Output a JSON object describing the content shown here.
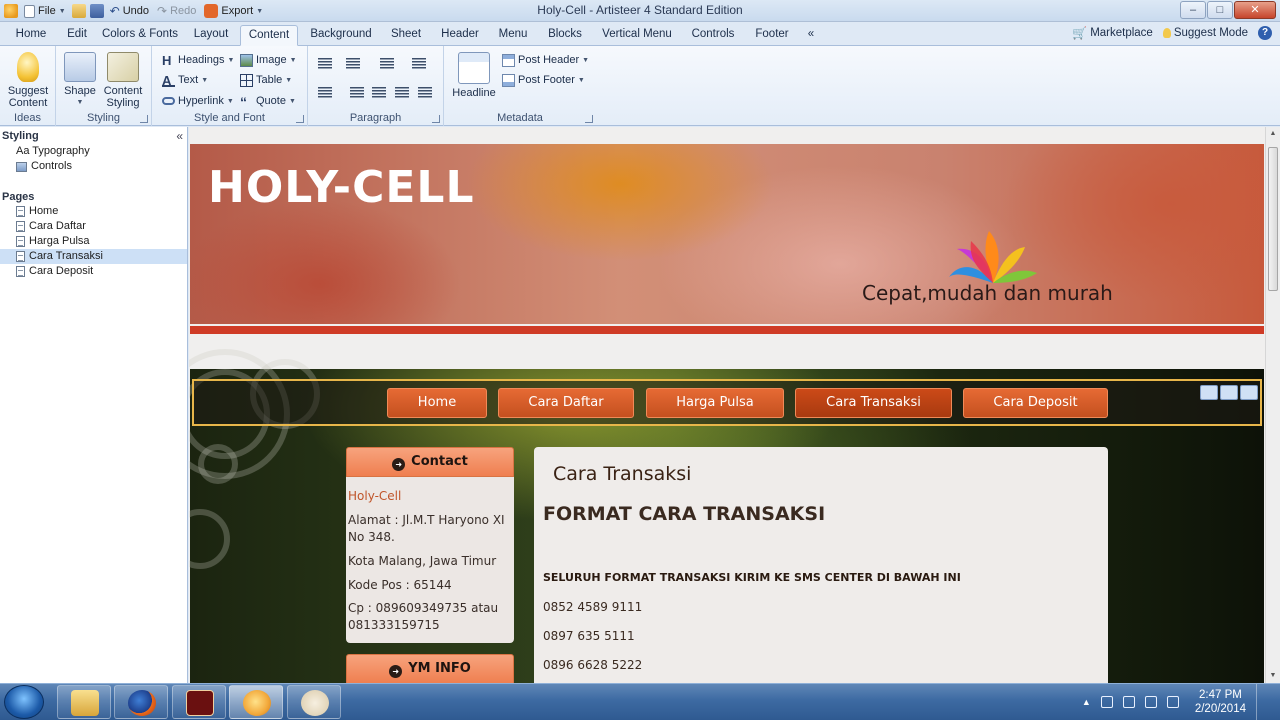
{
  "window": {
    "title": "Holy-Cell - Artisteer 4 Standard Edition",
    "qat": {
      "file": "File",
      "undo": "Undo",
      "redo": "Redo",
      "export": "Export"
    },
    "buttons": {
      "minimize": "–",
      "maximize": "□",
      "close": "✕"
    }
  },
  "ribbon_tabs": {
    "items": [
      "Home",
      "Edit",
      "Colors & Fonts",
      "Layout",
      "Content",
      "Background",
      "Sheet",
      "Header",
      "Menu",
      "Blocks",
      "Vertical Menu",
      "Controls",
      "Footer",
      "«"
    ],
    "active": "Content",
    "right": {
      "marketplace": "Marketplace",
      "suggest_mode": "Suggest Mode",
      "help": "?"
    }
  },
  "ribbon": {
    "ideas": {
      "label": "Ideas",
      "suggest_content": "Suggest Content"
    },
    "styling": {
      "label": "Styling",
      "shape": "Shape",
      "content_styling": "Content Styling"
    },
    "style_font": {
      "label": "Style and Font",
      "headings": "Headings",
      "text": "Text",
      "hyperlink": "Hyperlink",
      "image": "Image",
      "table": "Table",
      "quote": "Quote"
    },
    "paragraph": {
      "label": "Paragraph"
    },
    "metadata": {
      "label": "Metadata",
      "headline": "Headline",
      "post_header": "Post Header",
      "post_footer": "Post Footer"
    }
  },
  "left_panel": {
    "styling_head": "Styling",
    "styling_items": [
      "Aa Typography",
      "Controls"
    ],
    "pages_head": "Pages",
    "pages": [
      "Home",
      "Cara Daftar",
      "Harga Pulsa",
      "Cara Transaksi",
      "Cara Deposit"
    ],
    "selected_page": "Cara Transaksi",
    "collapse": "«"
  },
  "site": {
    "title": "HOLY-CELL",
    "slogan": "Cepat,mudah dan murah",
    "menu": [
      "Home",
      "Cara Daftar",
      "Harga Pulsa",
      "Cara Transaksi",
      "Cara Deposit"
    ],
    "active_menu": "Cara Transaksi",
    "sidebar": {
      "contact_head": "Contact",
      "contact_lines": [
        "Holy-Cell",
        "Alamat : Jl.M.T Haryono XI",
        "No 348.",
        "Kota Malang, Jawa Timur",
        "Kode Pos : 65144",
        "Cp : 089609349735 atau",
        "081333159715"
      ],
      "ym_head": "YM INFO"
    },
    "post": {
      "title": "Cara Transaksi",
      "heading": "FORMAT CARA TRANSAKSI",
      "bold_line": "SELURUH FORMAT TRANSAKSI KIRIM KE SMS CENTER DI BAWAH INI",
      "numbers": [
        "0852 4589 9111",
        "0897 635 5111",
        "0896 6628 5222"
      ]
    }
  },
  "taskbar": {
    "time": "2:47 PM",
    "date": "2/20/2014"
  },
  "colors": {
    "accent_orange": "#e66a34",
    "red_line": "#cf3b26",
    "ribbon_bg": "#dfe9f5",
    "taskbar": "#3d6aa2"
  }
}
